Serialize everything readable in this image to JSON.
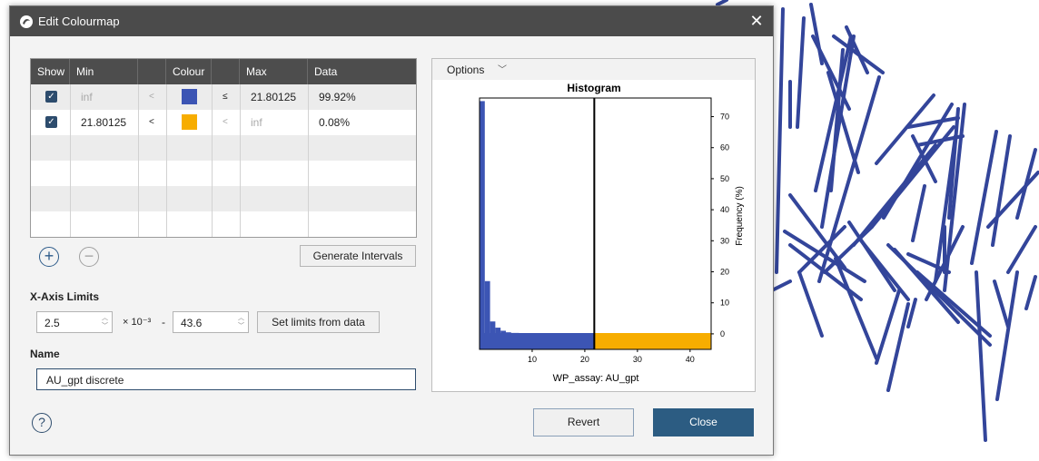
{
  "dialog": {
    "title": "Edit Colourmap",
    "close_glyph": "✕"
  },
  "table": {
    "headers": [
      "Show",
      "Min",
      "",
      "Colour",
      "",
      "Max",
      "Data"
    ],
    "rows": [
      {
        "show": true,
        "min": "inf",
        "op_left": "<",
        "colour": "#3c55b4",
        "op_right": "≤",
        "max": "21.80125",
        "data": "99.92%"
      },
      {
        "show": true,
        "min": "21.80125",
        "op_left": "<",
        "colour": "#f7ad00",
        "op_right": "<",
        "max": "inf",
        "data": "0.08%"
      }
    ]
  },
  "buttons": {
    "add_glyph": "+",
    "remove_glyph": "−",
    "generate_intervals": "Generate Intervals",
    "set_limits": "Set limits from data",
    "revert": "Revert",
    "close": "Close"
  },
  "xaxis_limits": {
    "label": "X-Axis Limits",
    "min": "2.5",
    "scale": "× 10⁻³",
    "separator": "-",
    "max": "43.6"
  },
  "name_field": {
    "label": "Name",
    "value": "AU_gpt discrete"
  },
  "help_glyph": "?",
  "histogram": {
    "options_label": "Options",
    "chart_data": {
      "type": "bar",
      "title": "Histogram",
      "xlabel": "WP_assay: AU_gpt",
      "ylabel": "Frequency (%)",
      "xlim": [
        0,
        44
      ],
      "ylim": [
        -5,
        76
      ],
      "xticks": [
        10,
        20,
        30,
        40
      ],
      "yticks": [
        0,
        10,
        20,
        30,
        40,
        50,
        60,
        70
      ],
      "threshold": 21.80125,
      "bins": [
        {
          "x0": 0.0,
          "x1": 1.0,
          "value": 75
        },
        {
          "x0": 1.0,
          "x1": 2.0,
          "value": 17
        },
        {
          "x0": 2.0,
          "x1": 3.0,
          "value": 4
        },
        {
          "x0": 3.0,
          "x1": 4.0,
          "value": 2
        },
        {
          "x0": 4.0,
          "x1": 5.0,
          "value": 1
        },
        {
          "x0": 5.0,
          "x1": 6.0,
          "value": 0.5
        },
        {
          "x0": 6.0,
          "x1": 7.5,
          "value": 0.3
        },
        {
          "x0": 7.5,
          "x1": 9.0,
          "value": 0.2
        },
        {
          "x0": 9.0,
          "x1": 12.0,
          "value": 0.1
        },
        {
          "x0": 12.0,
          "x1": 21.8,
          "value": 0.05
        }
      ],
      "colours": {
        "low": "#3c55b4",
        "high": "#f7ad00"
      }
    }
  }
}
